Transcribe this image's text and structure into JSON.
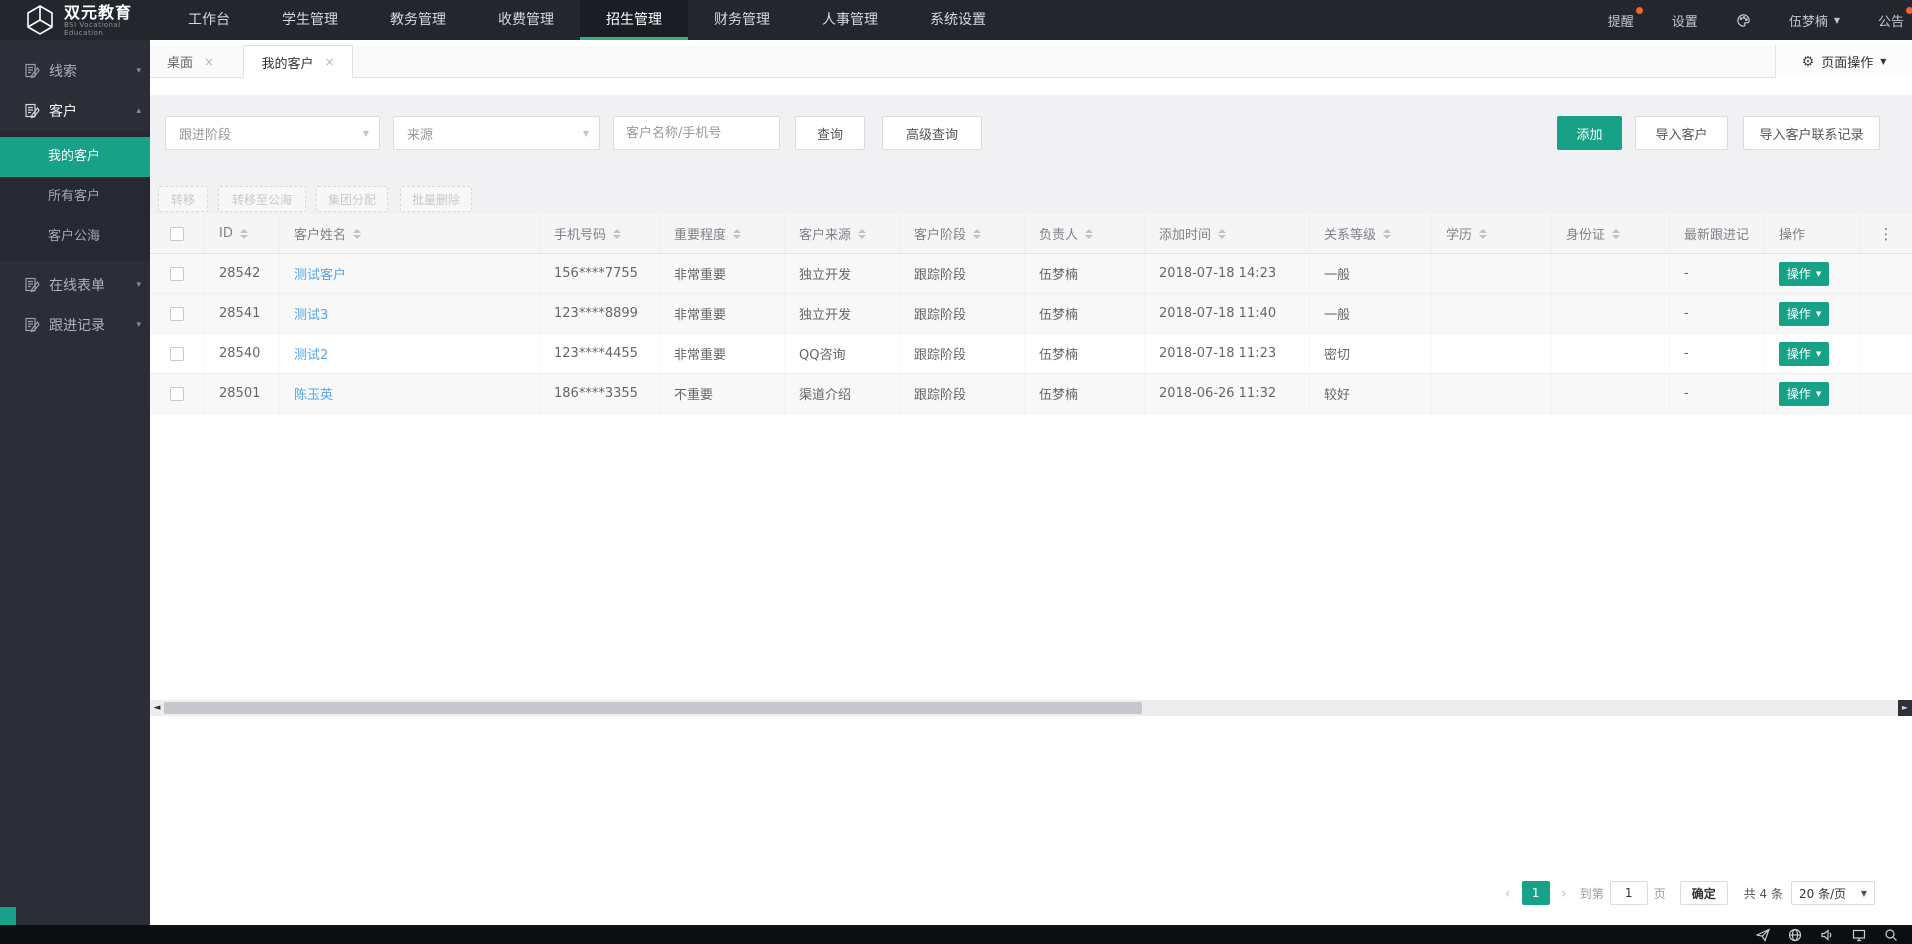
{
  "topbar": {
    "brand_title": "双元教育",
    "brand_subtitle": "BSI Vocational Education",
    "menu": [
      {
        "label": "工作台",
        "active": false
      },
      {
        "label": "学生管理",
        "active": false
      },
      {
        "label": "教务管理",
        "active": false
      },
      {
        "label": "收费管理",
        "active": false
      },
      {
        "label": "招生管理",
        "active": true
      },
      {
        "label": "财务管理",
        "active": false
      },
      {
        "label": "人事管理",
        "active": false
      },
      {
        "label": "系统设置",
        "active": false
      }
    ],
    "right": {
      "notice": "提醒",
      "settings": "设置",
      "user": "伍梦楠",
      "announce": "公告"
    }
  },
  "sidebar": {
    "clue": "线索",
    "customer": "客户",
    "my_customers": "我的客户",
    "all_customers": "所有客户",
    "customer_pool": "客户公海",
    "online_forms": "在线表单",
    "followup_records": "跟进记录"
  },
  "tabs": {
    "desktop": "桌面",
    "my_customers": "我的客户",
    "page_actions": "页面操作"
  },
  "filters": {
    "stage_placeholder": "跟进阶段",
    "source_placeholder": "来源",
    "keyword_placeholder": "客户名称/手机号",
    "query": "查询",
    "advanced_query": "高级查询",
    "add": "添加",
    "import_customers": "导入客户",
    "import_contact_records": "导入客户联系记录"
  },
  "bulk_actions": {
    "transfer": "转移",
    "transfer_pool": "转移至公海",
    "group_assign": "集团分配",
    "batch_delete": "批量删除"
  },
  "table": {
    "columns": [
      {
        "label": "ID"
      },
      {
        "label": "客户姓名"
      },
      {
        "label": "手机号码"
      },
      {
        "label": "重要程度"
      },
      {
        "label": "客户来源"
      },
      {
        "label": "客户阶段"
      },
      {
        "label": "负责人"
      },
      {
        "label": "添加时间"
      },
      {
        "label": "关系等级"
      },
      {
        "label": "学历"
      },
      {
        "label": "身份证"
      },
      {
        "label": "最新跟进记"
      },
      {
        "label": "操作"
      }
    ],
    "action_label": "操作",
    "rows": [
      {
        "id": "28542",
        "name": "测试客户",
        "phone": "156****7755",
        "importance": "非常重要",
        "source": "独立开发",
        "stage": "跟踪阶段",
        "owner": "伍梦楠",
        "added_time": "2018-07-18 14:23",
        "relation": "一般",
        "education": "",
        "id_card": "",
        "latest_record": "-"
      },
      {
        "id": "28541",
        "name": "测试3",
        "phone": "123****8899",
        "importance": "非常重要",
        "source": "独立开发",
        "stage": "跟踪阶段",
        "owner": "伍梦楠",
        "added_time": "2018-07-18 11:40",
        "relation": "一般",
        "education": "",
        "id_card": "",
        "latest_record": "-"
      },
      {
        "id": "28540",
        "name": "测试2",
        "phone": "123****4455",
        "importance": "非常重要",
        "source": "QQ咨询",
        "stage": "跟踪阶段",
        "owner": "伍梦楠",
        "added_time": "2018-07-18 11:23",
        "relation": "密切",
        "education": "",
        "id_card": "",
        "latest_record": "-"
      },
      {
        "id": "28501",
        "name": "陈玉英",
        "phone": "186****3355",
        "importance": "不重要",
        "source": "渠道介绍",
        "stage": "跟踪阶段",
        "owner": "伍梦楠",
        "added_time": "2018-06-26 11:32",
        "relation": "较好",
        "education": "",
        "id_card": "",
        "latest_record": "-"
      }
    ]
  },
  "pagination": {
    "prev": "‹",
    "current_page": "1",
    "next": "›",
    "goto_prefix": "到第",
    "goto_value": "1",
    "goto_suffix": "页",
    "confirm": "确定",
    "total": "共 4 条",
    "page_size": "20 条/页"
  },
  "icons": {
    "gear": "⚙",
    "close": "×",
    "chevron_down": "▾",
    "chevron_up": "▴",
    "caret_down": "▼",
    "ellipsis_v": "⋮",
    "arrow_left": "◄",
    "arrow_right": "►"
  },
  "colors": {
    "accent": "#17a287",
    "nav_underline": "#30b27d",
    "notification_dot": "#fb5f30",
    "link": "#55a6e8"
  }
}
